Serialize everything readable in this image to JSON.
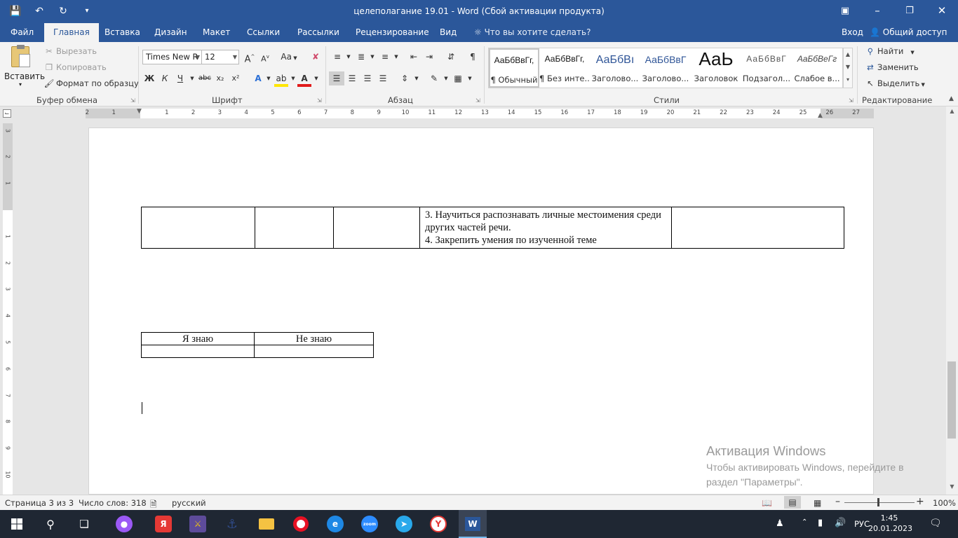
{
  "window": {
    "title": "целеполагание 19.01 - Word (Сбой активации продукта)",
    "qat": [
      "save-icon",
      "undo-icon",
      "redo-icon",
      "customize-icon"
    ],
    "controls": [
      "ribbon-display-icon",
      "minimize-icon",
      "restore-icon",
      "close-icon"
    ]
  },
  "tabs": [
    {
      "label": "Файл"
    },
    {
      "label": "Главная"
    },
    {
      "label": "Вставка"
    },
    {
      "label": "Дизайн"
    },
    {
      "label": "Макет"
    },
    {
      "label": "Ссылки"
    },
    {
      "label": "Рассылки"
    },
    {
      "label": "Рецензирование"
    },
    {
      "label": "Вид"
    }
  ],
  "tellme": "Что вы хотите сделать?",
  "signin": "Вход",
  "share": "Общий доступ",
  "ribbon": {
    "clipboard": {
      "paste": "Вставить",
      "cut": "Вырезать",
      "copy": "Копировать",
      "format_painter": "Формат по образцу",
      "label": "Буфер обмена"
    },
    "font": {
      "name": "Times New R",
      "size": "12",
      "label": "Шрифт",
      "grow": "A",
      "shrink": "A",
      "case": "Aa",
      "bold": "Ж",
      "italic": "К",
      "underline": "Ч",
      "strike": "abc",
      "sub": "x₂",
      "sup": "x²"
    },
    "paragraph": {
      "label": "Абзац"
    },
    "styles": {
      "label": "Стили",
      "items": [
        {
          "preview": "АаБбВвГг,",
          "name": "¶ Обычный"
        },
        {
          "preview": "АаБбВвГг,",
          "name": "¶ Без инте..."
        },
        {
          "preview": "АаБбВı",
          "name": "Заголово..."
        },
        {
          "preview": "АаБбВвГ",
          "name": "Заголово..."
        },
        {
          "preview": "АаЬ",
          "name": "Заголовок"
        },
        {
          "preview": "АаБбВвГ",
          "name": "Подзагол..."
        },
        {
          "preview": "АаБбВеГг",
          "name": "Слабое в..."
        }
      ]
    },
    "editing": {
      "find": "Найти",
      "replace": "Заменить",
      "select": "Выделить",
      "label": "Редактирование"
    }
  },
  "ruler": {
    "h_numbers": [
      "2",
      "1",
      "1",
      "2",
      "3",
      "4",
      "5",
      "6",
      "7",
      "8",
      "9",
      "10",
      "11",
      "12",
      "13",
      "14",
      "15",
      "16",
      "17",
      "18",
      "19",
      "20",
      "21",
      "22",
      "23",
      "24",
      "25",
      "26",
      "27"
    ],
    "v_numbers": [
      "3",
      "2",
      "1",
      "1",
      "2",
      "3",
      "4",
      "5",
      "6",
      "7",
      "8",
      "9",
      "10"
    ]
  },
  "document": {
    "table1": {
      "cells": [
        "",
        "",
        "",
        "3. Научиться распознавать личные местоимения среди других частей речи.\n4. Закрепить умения по изученной теме",
        ""
      ]
    },
    "table2": {
      "headers": [
        "Я знаю",
        "Не знаю"
      ],
      "row": [
        "",
        ""
      ]
    }
  },
  "watermark": {
    "title": "Активация Windows",
    "line1": "Чтобы активировать Windows, перейдите в",
    "line2": "раздел \"Параметры\"."
  },
  "status": {
    "page": "Страница 3 из 3",
    "words": "Число слов: 318",
    "language": "русский",
    "zoom": "100%",
    "zoom_level": 1.0
  },
  "taskbar": {
    "apps": [
      "start-icon",
      "search-icon",
      "task-view-icon",
      "alice-icon",
      "yandex-icon",
      "game-icon",
      "anchor-icon",
      "folder-icon",
      "opera-icon",
      "edge-icon",
      "zoom-icon",
      "telegram-icon",
      "yandex-browser-icon",
      "word-icon"
    ],
    "lang": "РУС",
    "time": "1:45",
    "date": "20.01.2023"
  }
}
